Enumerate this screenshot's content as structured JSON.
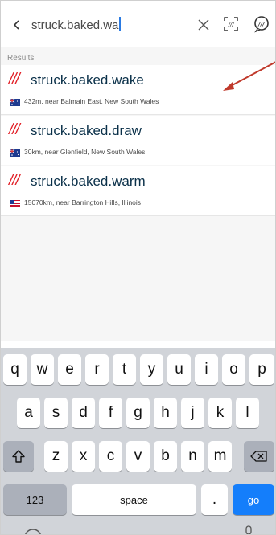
{
  "search": {
    "query": "struck.baked.wa"
  },
  "results": {
    "header": "Results",
    "items": [
      {
        "slashes": "///",
        "words": "struck.baked.wake",
        "country": "AU",
        "near": "432m, near Balmain East, New South Wales"
      },
      {
        "slashes": "///",
        "words": "struck.baked.draw",
        "country": "AU",
        "near": "30km, near Glenfield, New South Wales"
      },
      {
        "slashes": "///",
        "words": "struck.baked.warm",
        "country": "US",
        "near": "15070km, near Barrington Hills, Illinois"
      }
    ]
  },
  "keyboard": {
    "row1": [
      "q",
      "w",
      "e",
      "r",
      "t",
      "y",
      "u",
      "i",
      "o",
      "p"
    ],
    "row2": [
      "a",
      "s",
      "d",
      "f",
      "g",
      "h",
      "j",
      "k",
      "l"
    ],
    "row3": [
      "z",
      "x",
      "c",
      "v",
      "b",
      "n",
      "m"
    ],
    "numbers_label": "123",
    "space_label": "space",
    "period_label": ".",
    "go_label": "go"
  },
  "colors": {
    "accent_red": "#e11f26",
    "words_text": "#0a3049",
    "go_blue": "#147efb",
    "annotation_arrow": "#c0392b"
  },
  "icons": {
    "back": "chevron-left-icon",
    "clear": "close-icon",
    "scan": "scan-icon",
    "voice": "voice-icon",
    "shift": "shift-icon",
    "delete": "backspace-icon",
    "flag_au": "australia-flag-icon",
    "flag_us": "usa-flag-icon"
  }
}
